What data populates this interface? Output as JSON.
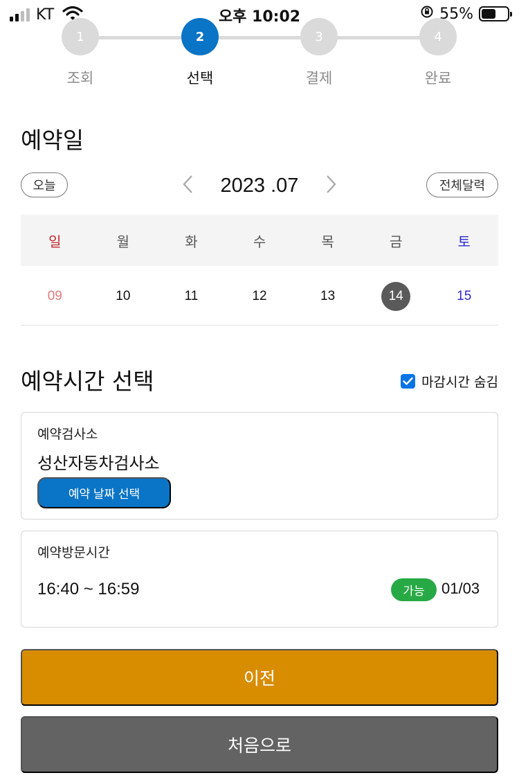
{
  "status_bar": {
    "carrier": "KT",
    "time": "오후 10:02",
    "battery_percent": "55%",
    "battery_level": 0.55
  },
  "stepper": {
    "steps": [
      {
        "number": "1",
        "label": "조회"
      },
      {
        "number": "2",
        "label": "선택"
      },
      {
        "number": "3",
        "label": "결제"
      },
      {
        "number": "4",
        "label": "완료"
      }
    ],
    "active_index": 1
  },
  "date_section": {
    "title": "예약일",
    "today_button": "오늘",
    "month": "2023 .07",
    "full_calendar_button": "전체달력",
    "weekdays": [
      "일",
      "월",
      "화",
      "수",
      "목",
      "금",
      "토"
    ],
    "days": [
      "09",
      "10",
      "11",
      "12",
      "13",
      "14",
      "15"
    ],
    "selected_day": "14"
  },
  "time_section": {
    "title": "예약시간 선택",
    "hide_closed_label": "마감시간 숨김",
    "hide_closed_checked": true
  },
  "center_card": {
    "label": "예약검사소",
    "value": "성산자동차검사소",
    "select_date_button": "예약 날짜 선택"
  },
  "visit_card": {
    "label": "예약방문시간",
    "time_range": "16:40 ~ 16:59",
    "status_badge": "가능",
    "count": "01/03"
  },
  "buttons": {
    "prev": "이전",
    "first": "처음으로"
  },
  "colors": {
    "primary_blue": "#0a74c6",
    "available_green": "#27a945",
    "prev_orange": "#d88c00",
    "first_gray": "#636363",
    "sunday_red": "#c0262e",
    "saturday_blue": "#2b2bd0"
  }
}
